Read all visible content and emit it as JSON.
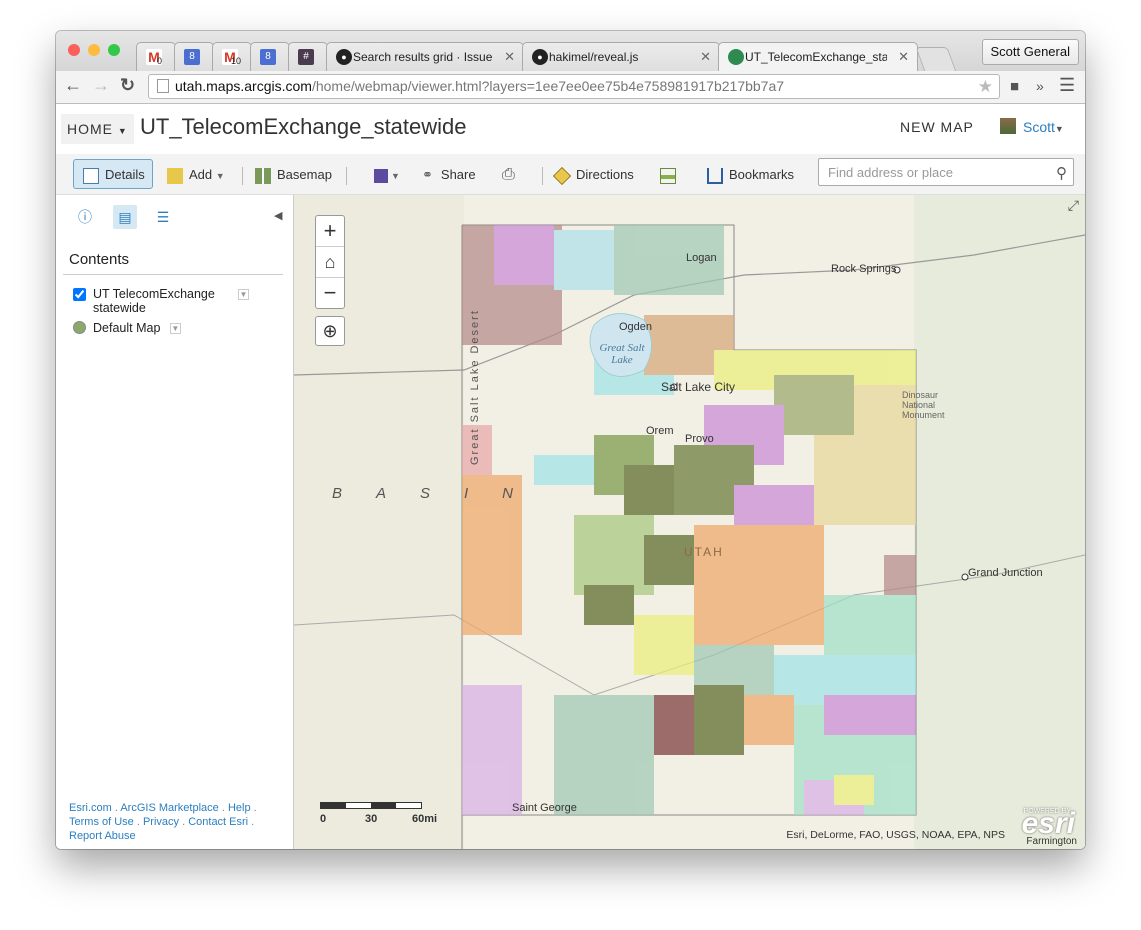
{
  "browser": {
    "tabs": [
      {
        "icon": "gmail-icon",
        "badge": "0",
        "title": ""
      },
      {
        "icon": "calendar-icon",
        "badge": "8",
        "title": ""
      },
      {
        "icon": "gmail-icon",
        "badge": "10",
        "title": ""
      },
      {
        "icon": "calendar-icon",
        "badge": "8",
        "title": ""
      },
      {
        "icon": "slack-icon",
        "badge": "#",
        "title": ""
      },
      {
        "icon": "github-icon",
        "badge": "",
        "title": "Search results grid · Issue"
      },
      {
        "icon": "github-icon",
        "badge": "",
        "title": "hakimel/reveal.js"
      },
      {
        "icon": "arcgis-globe-icon",
        "badge": "",
        "title": "UT_TelecomExchange_stat"
      }
    ],
    "profile": "Scott General",
    "url_host": "utah.maps.arcgis.com",
    "url_path": "/home/webmap/viewer.html?layers=1ee7ee0ee75b4e758981917b217bb7a7"
  },
  "header": {
    "home": "HOME",
    "title": "UT_TelecomExchange_statewide",
    "new_map": "NEW MAP",
    "user": "Scott"
  },
  "toolbar": {
    "details": "Details",
    "add": "Add",
    "basemap": "Basemap",
    "share": "Share",
    "directions": "Directions",
    "bookmarks": "Bookmarks",
    "search_placeholder": "Find address or place"
  },
  "sidebar": {
    "contents": "Contents",
    "layers": [
      {
        "name": "UT TelecomExchange statewide",
        "checked": true
      },
      {
        "name": "Default Map"
      }
    ],
    "footer": [
      "Esri.com",
      "ArcGIS Marketplace",
      "Help",
      "Terms of Use",
      "Privacy",
      "Contact Esri",
      "Report Abuse"
    ]
  },
  "map": {
    "labels": [
      "Rock Springs",
      "Logan",
      "Ogden",
      "Great Salt Lake",
      "Salt Lake City",
      "Orem",
      "Provo",
      "Great Salt Lake Desert",
      "BASIN",
      "UTAH",
      "Grand Junction",
      "Dinosaur National Monument",
      "Saint George",
      "Farmington"
    ],
    "scale": [
      "0",
      "30",
      "60mi"
    ],
    "attribution": "Esri, DeLorme, FAO, USGS, NOAA, EPA, NPS",
    "logo": "esri",
    "powered_by": "POWERED BY"
  }
}
